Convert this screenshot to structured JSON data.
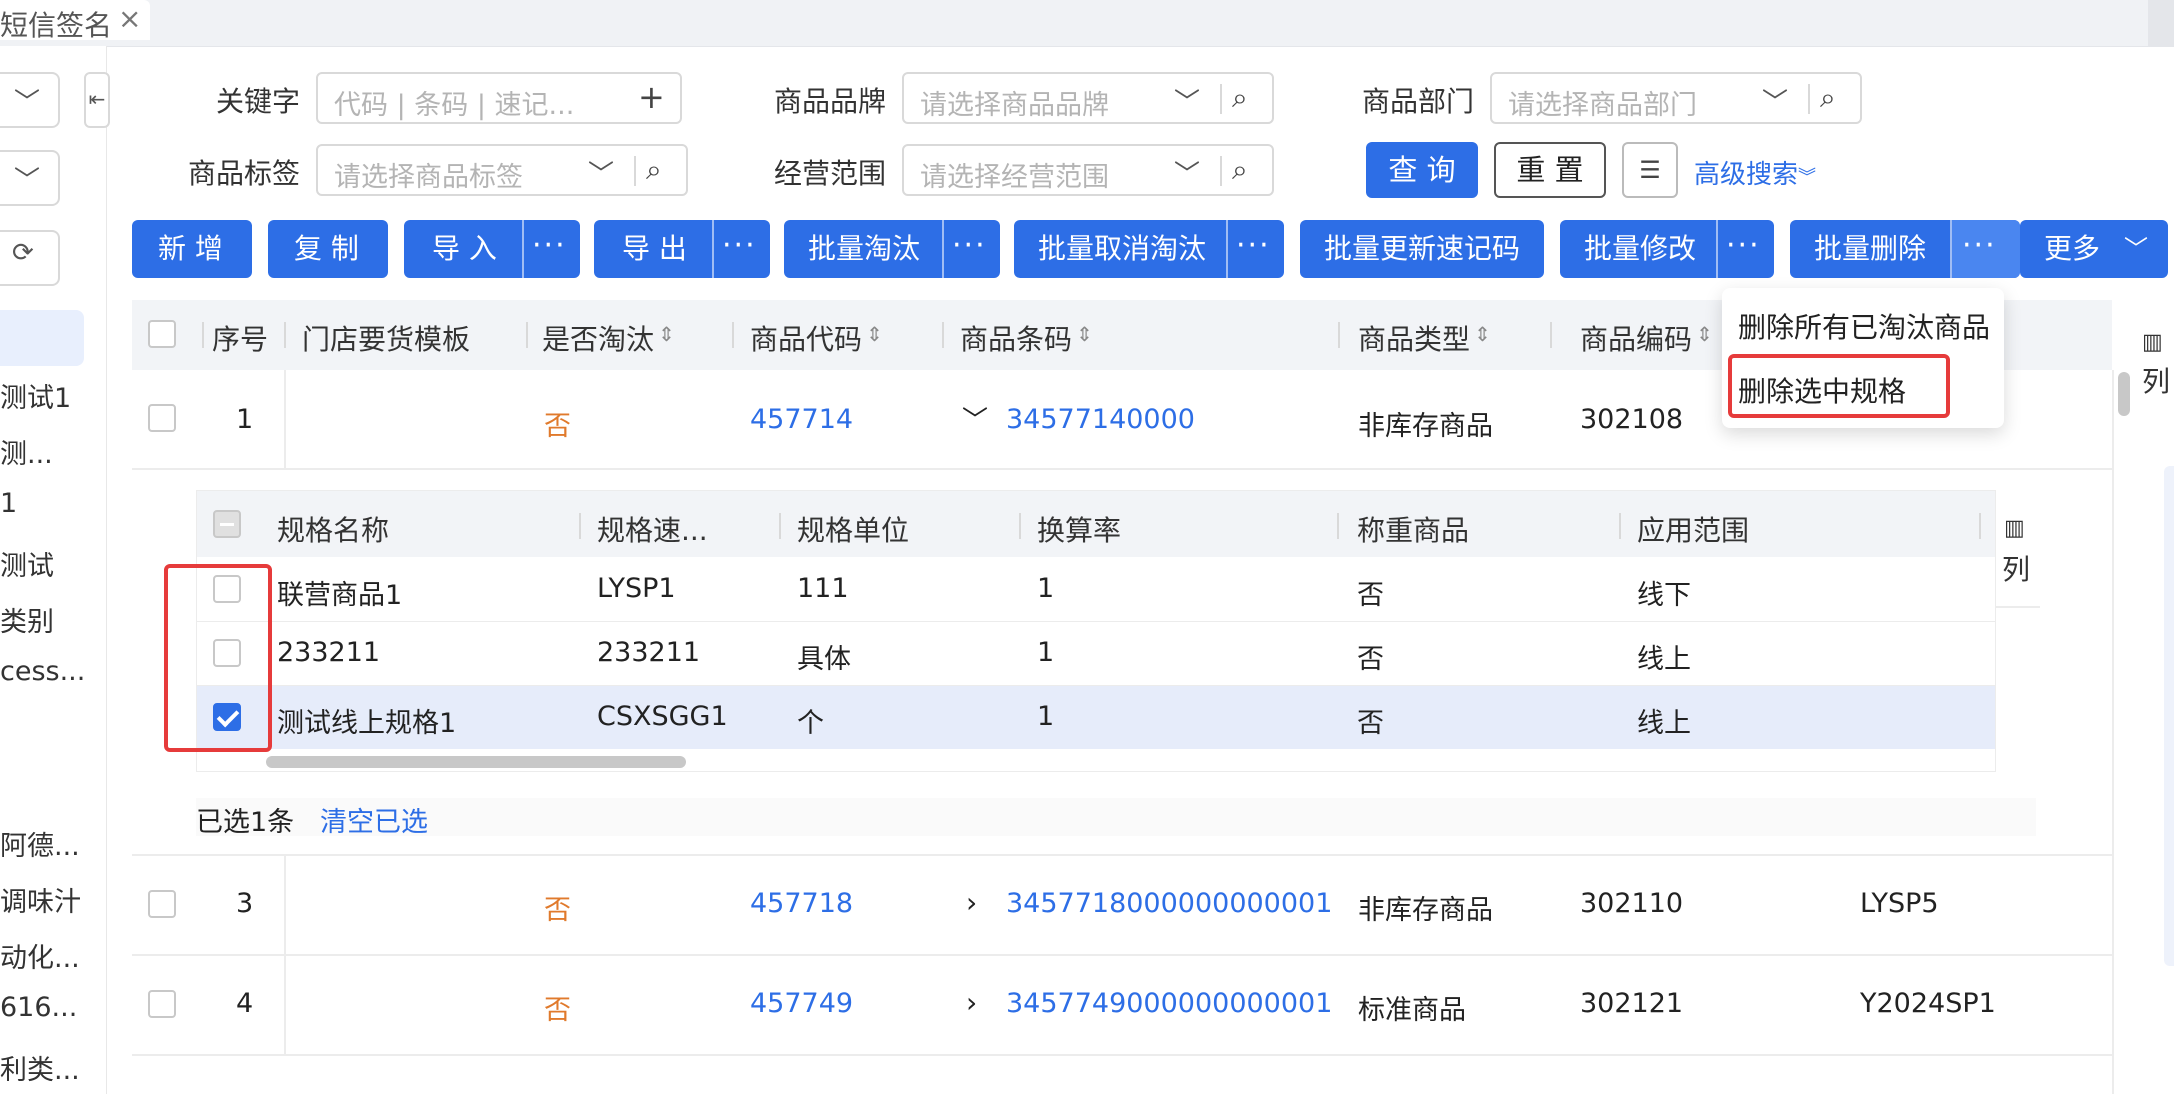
{
  "tab": {
    "title": "短信签名",
    "close": "×"
  },
  "left_tree": [
    "测试1",
    "测...",
    "1",
    "测试",
    "类别",
    "cess...",
    "阿德...",
    "调味汁",
    "动化...",
    "616...",
    "利类..."
  ],
  "filters": {
    "keyword": {
      "label": "关键字",
      "placeholder": "代码 | 条码 | 速记..."
    },
    "brand": {
      "label": "商品品牌",
      "placeholder": "请选择商品品牌"
    },
    "dept": {
      "label": "商品部门",
      "placeholder": "请选择商品部门"
    },
    "tag": {
      "label": "商品标签",
      "placeholder": "请选择商品标签"
    },
    "scope": {
      "label": "经营范围",
      "placeholder": "请选择经营范围"
    },
    "query_btn": "查 询",
    "reset_btn": "重 置",
    "advanced": "高级搜索"
  },
  "toolbar": {
    "add": "新 增",
    "copy": "复 制",
    "import": "导 入",
    "export": "导 出",
    "batch_eliminate": "批量淘汰",
    "batch_cancel_eliminate": "批量取消淘汰",
    "batch_update_code": "批量更新速记码",
    "batch_modify": "批量修改",
    "batch_delete": "批量删除",
    "more": "更多",
    "dots": "···"
  },
  "dropdown": [
    "删除所有已淘汰商品",
    "删除选中规格"
  ],
  "table": {
    "columns": [
      "序号",
      "门店要货模板",
      "是否淘汰",
      "商品代码",
      "商品条码",
      "商品类型",
      "商品编码"
    ],
    "column_settings": "列",
    "rows": [
      {
        "seq": "1",
        "eliminated": "否",
        "code": "457714",
        "barcode": "34577140000",
        "type": "非库存商品",
        "num": "302108",
        "extra": ""
      },
      {
        "seq": "3",
        "eliminated": "否",
        "code": "457718",
        "barcode": "3457718000000000001",
        "type": "非库存商品",
        "num": "302110",
        "extra": "LYSP5"
      },
      {
        "seq": "4",
        "eliminated": "否",
        "code": "457749",
        "barcode": "3457749000000000001",
        "type": "标准商品",
        "num": "302121",
        "extra": "Y2024SP1"
      }
    ]
  },
  "subtable": {
    "columns": [
      "规格名称",
      "规格速...",
      "规格单位",
      "换算率",
      "称重商品",
      "应用范围"
    ],
    "column_settings": "列",
    "rows": [
      {
        "name": "联营商品1",
        "code": "LYSP1",
        "unit": "111",
        "rate": "1",
        "weigh": "否",
        "scope": "线下",
        "checked": false
      },
      {
        "name": "233211",
        "code": "233211",
        "unit": "具体",
        "rate": "1",
        "weigh": "否",
        "scope": "线上",
        "checked": false
      },
      {
        "name": "测试线上规格1",
        "code": "CSXSGG1",
        "unit": "个",
        "rate": "1",
        "weigh": "否",
        "scope": "线上",
        "checked": true
      }
    ],
    "selected_info": "已选1条",
    "clear_selected": "清空已选"
  }
}
